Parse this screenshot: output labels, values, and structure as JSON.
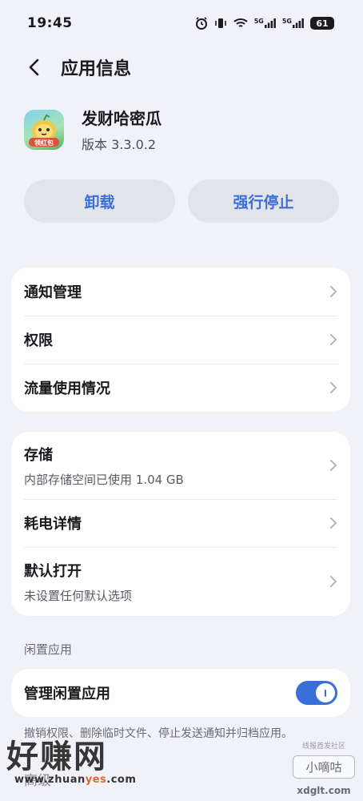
{
  "status_bar": {
    "time": "19:45",
    "signal_1": "5G",
    "signal_2": "5G",
    "battery": "61"
  },
  "header": {
    "title": "应用信息"
  },
  "app": {
    "name": "发财哈密瓜",
    "version": "版本 3.3.0.2",
    "icon_text": "领红包"
  },
  "actions": {
    "uninstall": "卸载",
    "force_stop": "强行停止"
  },
  "card1": {
    "items": [
      {
        "title": "通知管理"
      },
      {
        "title": "权限"
      },
      {
        "title": "流量使用情况"
      }
    ]
  },
  "card2": {
    "items": [
      {
        "title": "存储",
        "subtitle": "内部存储空间已使用 1.04 GB"
      },
      {
        "title": "耗电详情"
      },
      {
        "title": "默认打开",
        "subtitle": "未设置任何默认选项"
      }
    ]
  },
  "idle": {
    "section_title": "闲置应用",
    "toggle_label": "管理闲置应用",
    "toggle_on": true,
    "footnote": "撤销权限、删除临时文件、停止发送通知并归档应用。",
    "next_row": "高级"
  },
  "watermark": {
    "left_text": "好赚网",
    "domain_prefix": "www.zhuan",
    "domain_highlight": "yes",
    "domain_suffix": ".com",
    "right_small": "线报首发社区",
    "right_box": "小嘀咕",
    "right_url": "xdglt.com"
  },
  "colors": {
    "accent": "#3a6fd9",
    "background": "#f1f2f7",
    "card": "#ffffff"
  }
}
